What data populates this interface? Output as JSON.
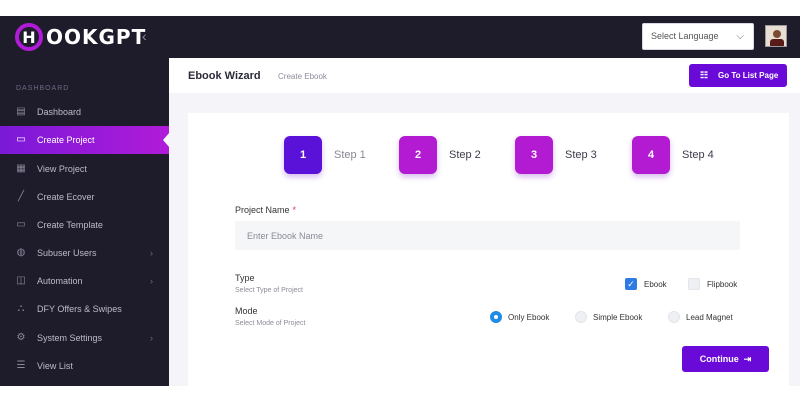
{
  "app": {
    "logo_text": "OOKGPT",
    "logo_mark": "H"
  },
  "header": {
    "collapse_icon": "chevron-left-icon",
    "language": {
      "value": "Select Language",
      "caret": "⌵"
    }
  },
  "sidebar": {
    "heading": "DASHBOARD",
    "items": [
      {
        "label": "Dashboard",
        "icon": "dashboard-icon",
        "glyph": "▤"
      },
      {
        "label": "Create Project",
        "icon": "window-icon",
        "glyph": "▭"
      },
      {
        "label": "View Project",
        "icon": "document-icon",
        "glyph": "▦"
      },
      {
        "label": "Create Ecover",
        "icon": "brush-icon",
        "glyph": "╱"
      },
      {
        "label": "Create Template",
        "icon": "template-icon",
        "glyph": "▭"
      },
      {
        "label": "Subuser Users",
        "icon": "users-icon",
        "glyph": "◍"
      },
      {
        "label": "Automation",
        "icon": "automation-icon",
        "glyph": "◫"
      },
      {
        "label": "DFY Offers & Swipes",
        "icon": "gift-icon",
        "glyph": "⛬"
      },
      {
        "label": "System Settings",
        "icon": "settings-icon",
        "glyph": "⚙"
      },
      {
        "label": "View List",
        "icon": "list-icon",
        "glyph": "☰"
      }
    ],
    "chevron": "›"
  },
  "breadcrumb": {
    "title": "Ebook Wizard",
    "sub": "Create Ebook",
    "list_button": "Go To List Page",
    "list_icon": "☷"
  },
  "wizard": {
    "steps": [
      {
        "number": "1",
        "label": "Step 1"
      },
      {
        "number": "2",
        "label": "Step 2"
      },
      {
        "number": "3",
        "label": "Step 3"
      },
      {
        "number": "4",
        "label": "Step 4"
      }
    ],
    "project_name": {
      "label": "Project Name",
      "required": "*",
      "placeholder": "Enter Ebook Name"
    },
    "type": {
      "label": "Type",
      "sub": "Select Type of Project",
      "options": [
        {
          "label": "Ebook",
          "checked": true
        },
        {
          "label": "Flipbook",
          "checked": false
        }
      ]
    },
    "mode": {
      "label": "Mode",
      "sub": "Select Mode of Project",
      "options": [
        {
          "label": "Only Ebook",
          "selected": true
        },
        {
          "label": "Simple Ebook",
          "selected": false
        },
        {
          "label": "Lead Magnet",
          "selected": false
        }
      ]
    },
    "continue_label": "Continue",
    "continue_icon": "⇥",
    "check_glyph": "✓"
  },
  "colors": {
    "accent": "#6a0ad8",
    "sidebar_bg": "#1e1c2b",
    "step_active": "#5b12d8",
    "step_pending": "#b31bd3",
    "checkbox": "#2e7be6"
  }
}
